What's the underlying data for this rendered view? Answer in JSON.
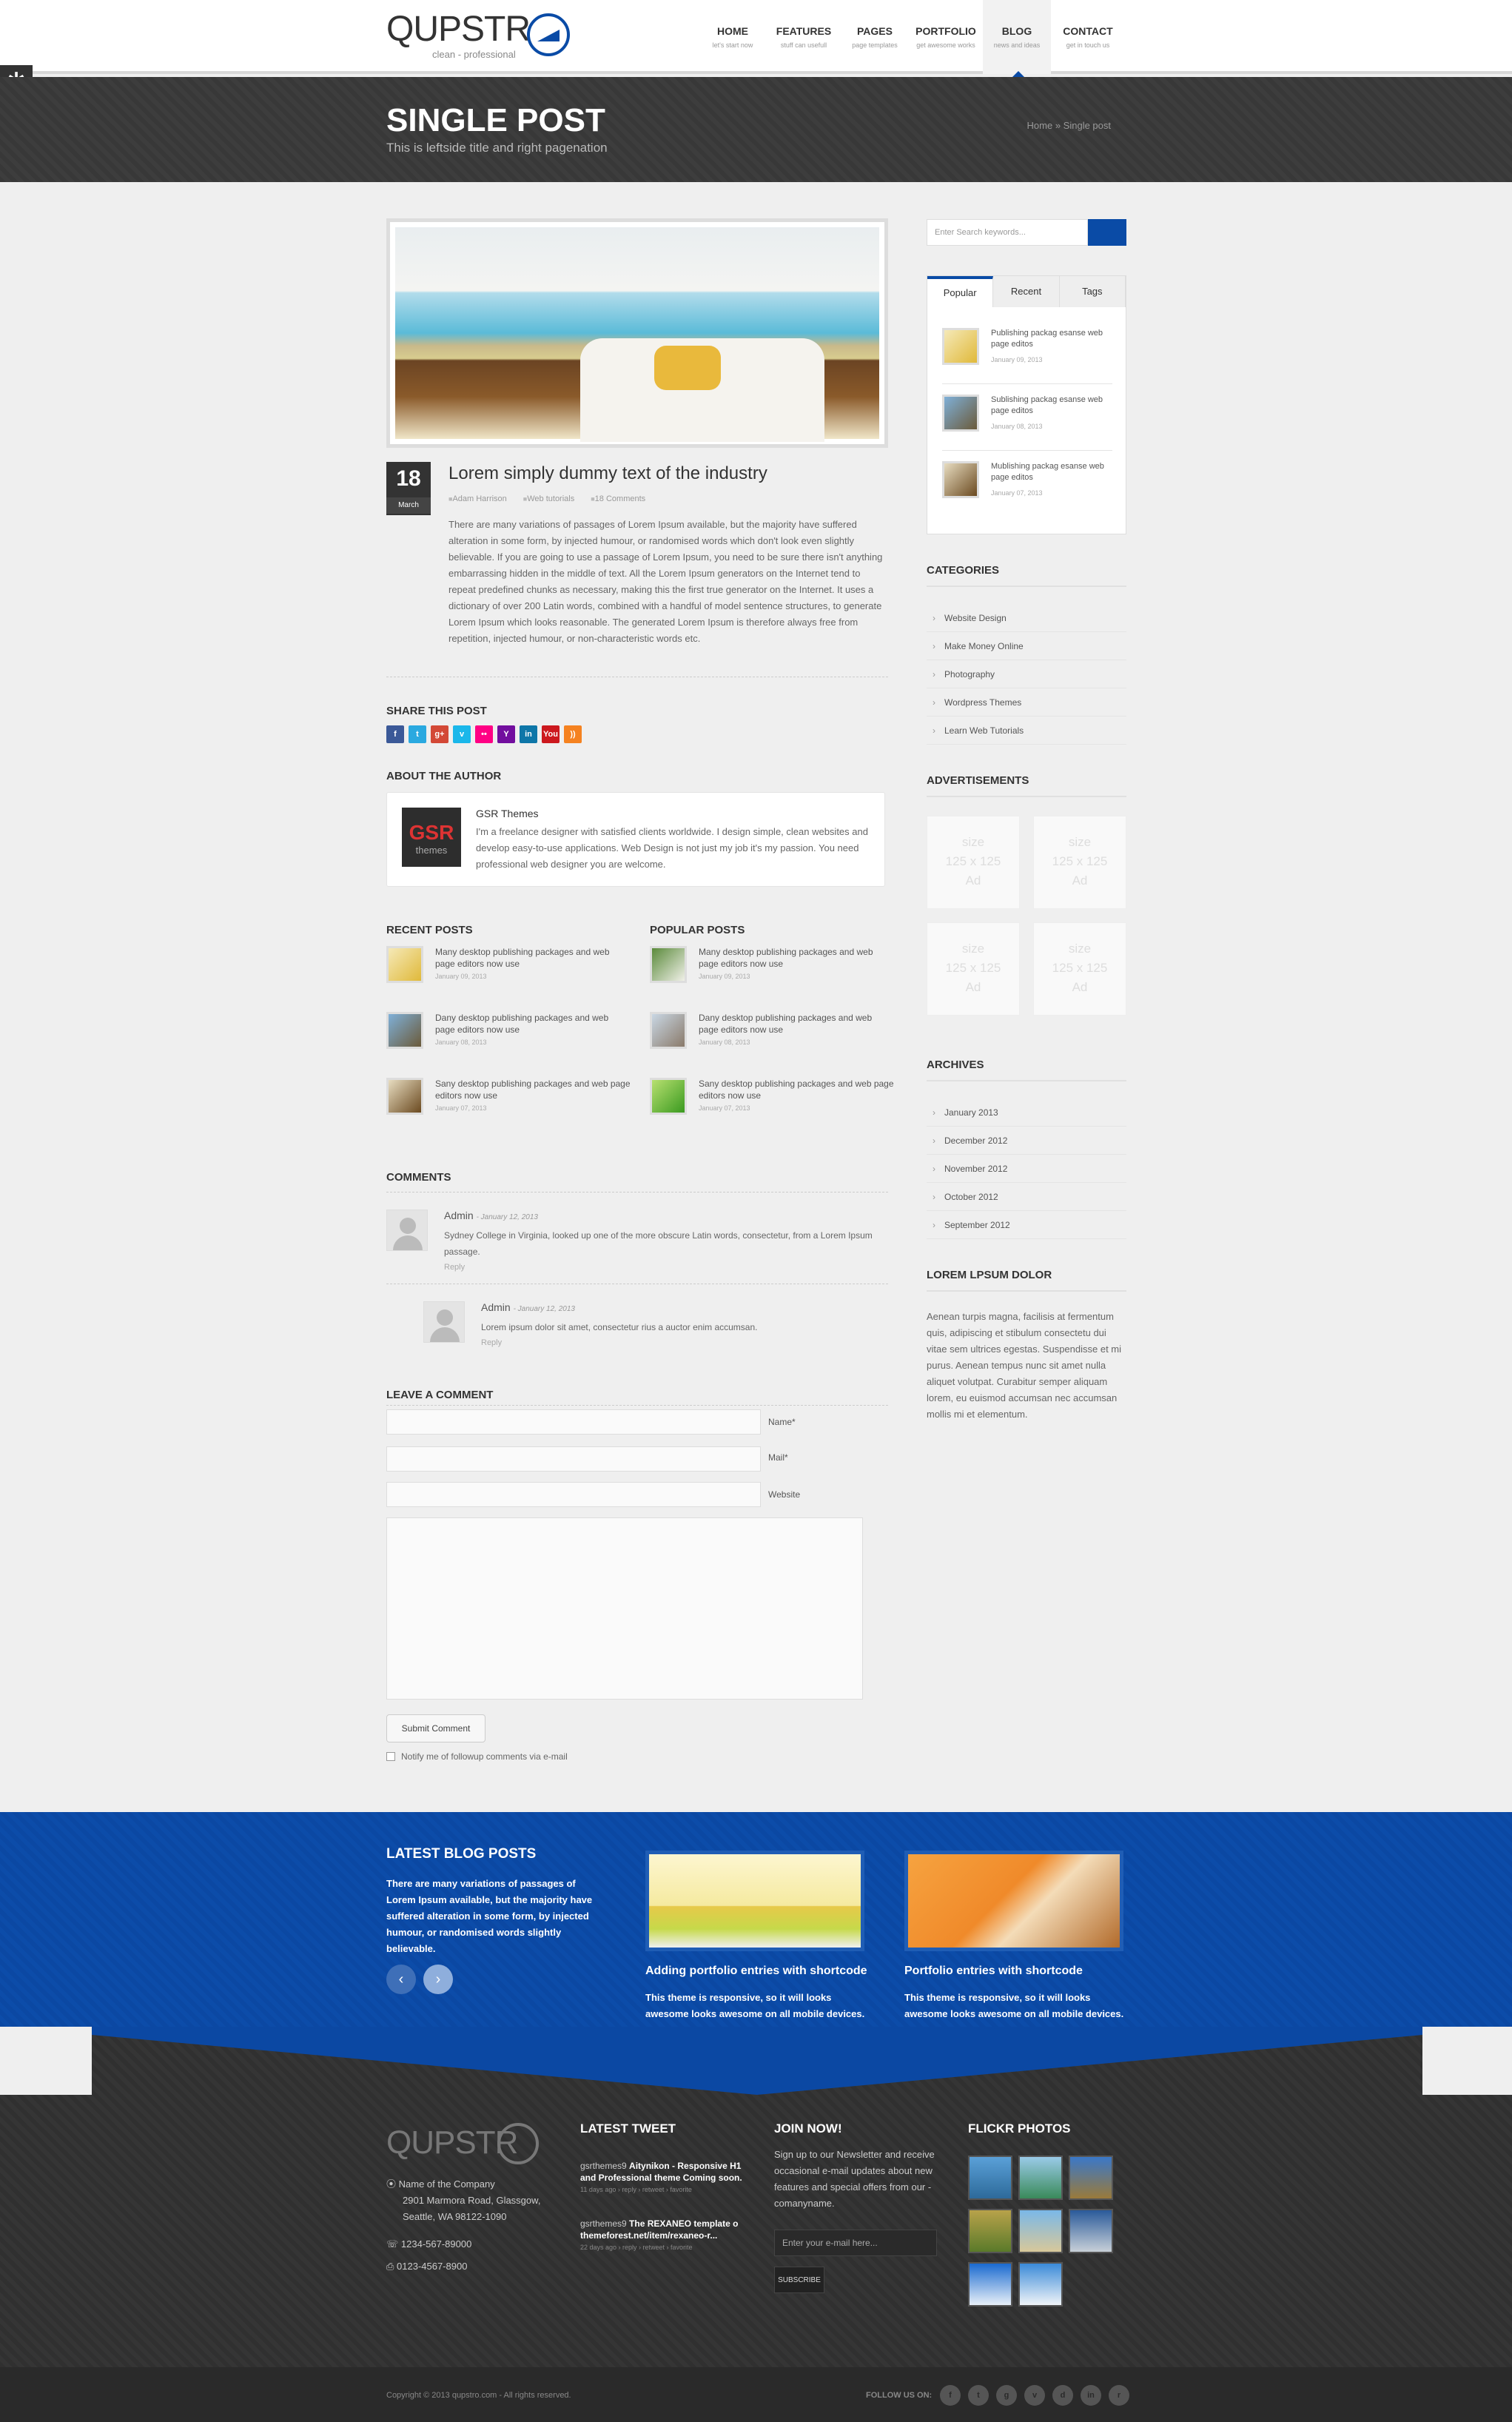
{
  "header": {
    "logo_text": "QUPSTR",
    "logo_tagline": "clean - professional",
    "nav": [
      {
        "label": "HOME",
        "sub": "let's start now"
      },
      {
        "label": "FEATURES",
        "sub": "stuff can usefull"
      },
      {
        "label": "PAGES",
        "sub": "page templates"
      },
      {
        "label": "PORTFOLIO",
        "sub": "get awesome works"
      },
      {
        "label": "BLOG",
        "sub": "news and ideas",
        "active": true
      },
      {
        "label": "CONTACT",
        "sub": "get in touch us"
      }
    ],
    "settings_icon": "gear-icon"
  },
  "titlebar": {
    "title": "SINGLE POST",
    "subtitle": "This is leftside title and right pagenation",
    "breadcrumb": "Home » Single post"
  },
  "post": {
    "day": "18",
    "month": "March",
    "title": "Lorem simply dummy text of the industry",
    "author": "Adam Harrison",
    "category": "Web tutorials",
    "comments": "18 Comments",
    "body": "There are many variations of passages of Lorem Ipsum available, but the majority have suffered alteration in some form, by injected humour, or randomised words which don't look even slightly believable. If you are going to use a passage of Lorem Ipsum, you need to be sure there isn't anything embarrassing hidden in the middle of text. All the Lorem Ipsum generators on the Internet tend to repeat predefined chunks as necessary, making this the first true generator on the Internet. It uses a dictionary of over 200 Latin words, combined with a handful of model sentence structures, to generate Lorem Ipsum which looks reasonable. The generated Lorem Ipsum is therefore always free from repetition, injected humour, or non-characteristic words etc."
  },
  "share": {
    "title": "SHARE THIS POST",
    "icons": [
      {
        "name": "facebook-icon",
        "glyph": "f",
        "color": "#3b5998"
      },
      {
        "name": "twitter-icon",
        "glyph": "t",
        "color": "#2aa9e0"
      },
      {
        "name": "googleplus-icon",
        "glyph": "g+",
        "color": "#d34836"
      },
      {
        "name": "vimeo-icon",
        "glyph": "v",
        "color": "#1ab7ea"
      },
      {
        "name": "flickr-icon",
        "glyph": "••",
        "color": "#ff0084"
      },
      {
        "name": "yahoo-icon",
        "glyph": "Y",
        "color": "#720e9e"
      },
      {
        "name": "linkedin-icon",
        "glyph": "in",
        "color": "#0e76a8"
      },
      {
        "name": "youtube-icon",
        "glyph": "You",
        "color": "#cc181e"
      },
      {
        "name": "rss-icon",
        "glyph": "))",
        "color": "#f58220"
      }
    ]
  },
  "author_box": {
    "title": "ABOUT THE AUTHOR",
    "avatar_text": "GSR",
    "avatar_sub": "themes",
    "name": "GSR Themes",
    "bio": "I'm a freelance designer with satisfied clients worldwide. I design simple, clean websites and develop easy-to-use applications. Web Design is not just my job it's my passion. You need professional web designer you are welcome."
  },
  "recent_posts": {
    "title": "RECENT POSTS",
    "items": [
      {
        "text": "Many desktop publishing packages and web page editors now use",
        "date": "January 09, 2013"
      },
      {
        "text": "Dany desktop publishing packages and web page editors now use",
        "date": "January 08, 2013"
      },
      {
        "text": "Sany desktop publishing packages and web page editors now use",
        "date": "January 07, 2013"
      }
    ]
  },
  "popular_posts": {
    "title": "POPULAR POSTS",
    "items": [
      {
        "text": "Many desktop publishing packages and web page editors now use",
        "date": "January 09, 2013"
      },
      {
        "text": "Dany desktop publishing packages and web page editors now use",
        "date": "January 08, 2013"
      },
      {
        "text": "Sany desktop publishing packages and web page editors now use",
        "date": "January 07, 2013"
      }
    ]
  },
  "comments": {
    "title": "COMMENTS",
    "items": [
      {
        "name": "Admin",
        "date": "- January 12, 2013",
        "text": "Sydney College in Virginia, looked up one of the more obscure Latin words, consectetur, from a Lorem Ipsum passage.",
        "reply": "Reply"
      },
      {
        "name": "Admin",
        "date": "- January 12, 2013",
        "text": "Lorem ipsum dolor sit amet, consectetur rius a auctor enim accumsan.",
        "reply": "Reply"
      }
    ]
  },
  "comment_form": {
    "title": "LEAVE A COMMENT",
    "name_label": "Name*",
    "mail_label": "Mail*",
    "website_label": "Website",
    "submit": "Submit Comment",
    "notify": "Notify me of followup comments via e-mail"
  },
  "sidebar": {
    "search_placeholder": "Enter Search keywords...",
    "tabs": [
      "Popular",
      "Recent",
      "Tags"
    ],
    "tab_posts": [
      {
        "text": "Publishing packag esanse web page editos",
        "date": "January 09, 2013"
      },
      {
        "text": "Sublishing packag esanse web page editos",
        "date": "January 08, 2013"
      },
      {
        "text": "Mublishing packag esanse web page editos",
        "date": "January 07, 2013"
      }
    ],
    "categories_title": "CATEGORIES",
    "categories": [
      "Website Design",
      "Make Money Online",
      "Photography",
      "Wordpress Themes",
      "Learn Web Tutorials"
    ],
    "ads_title": "ADVERTISEMENTS",
    "ad_lines": [
      "size",
      "125 x 125",
      "Ad"
    ],
    "archives_title": "ARCHIVES",
    "archives": [
      "January 2013",
      "December 2012",
      "November 2012",
      "October 2012",
      "September 2012"
    ],
    "lorem_title": "LOREM LPSUM DOLOR",
    "lorem_text": "Aenean turpis magna, facilisis at fermentum quis, adipiscing et stibulum consectetu dui vitae sem ultrices egestas. Suspendisse et mi purus. Aenean tempus nunc sit amet nulla aliquet volutpat. Curabitur semper aliquam lorem, eu euismod accumsan nec accumsan mollis mi et elementum."
  },
  "latest_band": {
    "title": "LATEST BLOG POSTS",
    "text": "There are many variations of passages of Lorem Ipsum available, but the majority have suffered alteration in some form, by injected humour, or randomised words slightly believable.",
    "prev_icon": "chevron-left-icon",
    "next_icon": "chevron-right-icon",
    "items": [
      {
        "title": "Adding portfolio entries with shortcode",
        "text": "This theme is responsive, so it will looks awesome looks awesome on all mobile devices."
      },
      {
        "title": "Portfolio entries with shortcode",
        "text": "This theme is responsive, so it will looks awesome looks awesome on all mobile devices."
      }
    ]
  },
  "footer": {
    "logo_text": "QUPSTR",
    "address": [
      "Name of the Company",
      "2901 Marmora Road, Glassgow,",
      "Seattle, WA 98122-1090"
    ],
    "phone": "1234-567-89000",
    "fax": "0123-4567-8900",
    "tweet_title": "LATEST TWEET",
    "tweets": [
      {
        "user": "gsrthemes9",
        "text": "Aitynikon - Responsive H1 and Professional theme Coming soon.",
        "meta": "11 days ago › reply › retweet › favorite"
      },
      {
        "user": "gsrthemes9",
        "text": "The REXANEO template o themeforest.net/item/rexaneo-r...",
        "meta": "22 days ago › reply › retweet › favorite"
      }
    ],
    "join_title": "JOIN NOW!",
    "join_text": "Sign up to our Newsletter and receive occasional e-mail updates about new features and special offers from our - comanyname.",
    "email_placeholder": "Enter your e-mail here...",
    "subscribe": "SUBSCRIBE",
    "flickr_title": "FLICKR PHOTOS",
    "copyright": "Copyright © 2013 qupstro.com - All rights reserved.",
    "follow_label": "FOLLOW US ON:",
    "follow_icons": [
      "facebook-icon",
      "twitter-icon",
      "googleplus-icon",
      "vimeo-icon",
      "dribbble-icon",
      "linkedin-icon",
      "rss-icon"
    ]
  },
  "colors": {
    "accent": "#0a4ba6",
    "dark": "#333333",
    "band": "#0b48a3"
  }
}
